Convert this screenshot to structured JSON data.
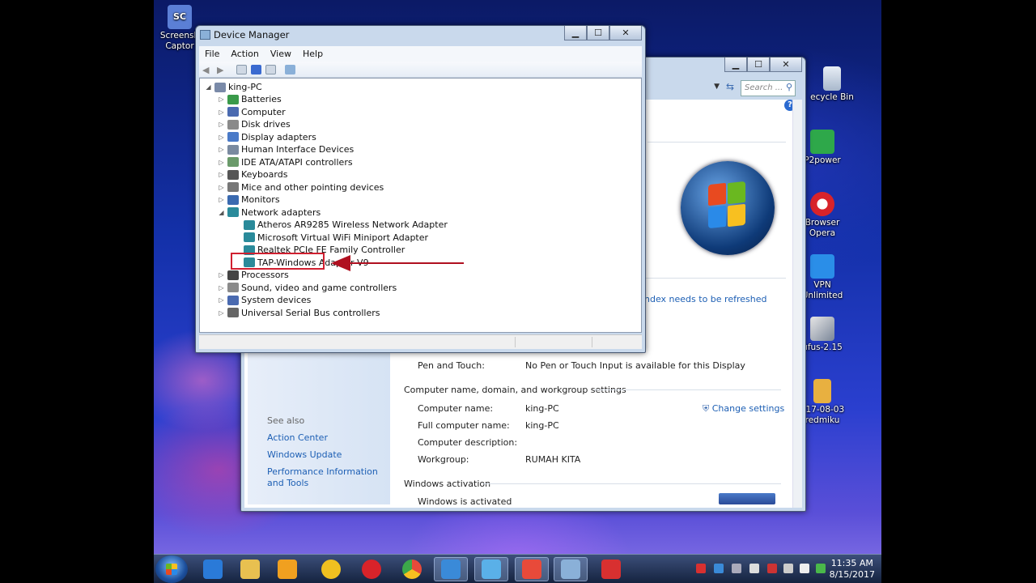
{
  "desktop_icons": [
    {
      "label": "Screensh\nCaptor",
      "color": "#5b7fd6"
    },
    {
      "label": "ecycle Bin",
      "color": "#c9d6e6"
    },
    {
      "label": "P2power",
      "color": "#2ea84a"
    },
    {
      "label": "Browser\nOpera",
      "color": "#d8232a"
    },
    {
      "label": "VPN\nUnlimited",
      "color": "#2a8ee8"
    },
    {
      "label": "ufus-2.15",
      "color": "#9aa6b8"
    },
    {
      "label": "017-08-03\nredmiku",
      "color": "#e8b040"
    }
  ],
  "device_manager": {
    "title": "Device Manager",
    "menu": [
      "File",
      "Action",
      "View",
      "Help"
    ],
    "root": "king-PC",
    "nodes": [
      {
        "label": "Batteries",
        "expanded": false,
        "color": "#3a9a4a"
      },
      {
        "label": "Computer",
        "expanded": false,
        "color": "#4a6ab0"
      },
      {
        "label": "Disk drives",
        "expanded": false,
        "color": "#8a8a8a"
      },
      {
        "label": "Display adapters",
        "expanded": false,
        "color": "#4a7ac8"
      },
      {
        "label": "Human Interface Devices",
        "expanded": false,
        "color": "#7a8aa0"
      },
      {
        "label": "IDE ATA/ATAPI controllers",
        "expanded": false,
        "color": "#6a9a6a"
      },
      {
        "label": "Keyboards",
        "expanded": false,
        "color": "#555"
      },
      {
        "label": "Mice and other pointing devices",
        "expanded": false,
        "color": "#777"
      },
      {
        "label": "Monitors",
        "expanded": false,
        "color": "#3a6ab0"
      },
      {
        "label": "Network adapters",
        "expanded": true,
        "color": "#2a8a9a"
      },
      {
        "label": "Atheros AR9285 Wireless Network Adapter",
        "child": true,
        "color": "#2a8a9a"
      },
      {
        "label": "Microsoft Virtual WiFi Miniport Adapter",
        "child": true,
        "color": "#2a8a9a"
      },
      {
        "label": "Realtek PCIe FE Family Controller",
        "child": true,
        "color": "#2a8a9a"
      },
      {
        "label": "TAP-Windows Adapter V9",
        "child": true,
        "color": "#2a8a9a"
      },
      {
        "label": "Processors",
        "expanded": false,
        "color": "#444"
      },
      {
        "label": "Sound, video and game controllers",
        "expanded": false,
        "color": "#8a8a8a"
      },
      {
        "label": "System devices",
        "expanded": false,
        "color": "#4a6ab0"
      },
      {
        "label": "Universal Serial Bus controllers",
        "expanded": false,
        "color": "#666"
      }
    ]
  },
  "system_window": {
    "search_placeholder": "Search ...",
    "index_link": "ndex needs to be refreshed",
    "pen_touch_label": "Pen and Touch:",
    "pen_touch_value": "No Pen or Touch Input is available for this Display",
    "section_computer": "Computer name, domain, and workgroup settings",
    "computer_name_label": "Computer name:",
    "computer_name_value": "king-PC",
    "full_name_label": "Full computer name:",
    "full_name_value": "king-PC",
    "description_label": "Computer description:",
    "workgroup_label": "Workgroup:",
    "workgroup_value": "RUMAH KITA",
    "change_settings": "Change settings",
    "section_activation": "Windows activation",
    "activated": "Windows is activated",
    "see_also": "See also",
    "links": [
      "Action Center",
      "Windows Update",
      "Performance Information and Tools"
    ]
  },
  "taskbar": {
    "time": "11:35 AM",
    "date": "8/15/2017",
    "apps": [
      {
        "name": "ie-icon",
        "color": "#2a7ad8"
      },
      {
        "name": "explorer-icon",
        "color": "#e8c050"
      },
      {
        "name": "media-player-icon",
        "color": "#f0a020"
      },
      {
        "name": "aimp-icon",
        "color": "#f0c020"
      },
      {
        "name": "opera-icon",
        "color": "#d8232a"
      },
      {
        "name": "chrome-icon",
        "color": "#3ca84a"
      },
      {
        "name": "screenshot-captor-icon",
        "color": "#3a8ad8"
      },
      {
        "name": "system-icon",
        "color": "#5ab0e8"
      },
      {
        "name": "control-panel-icon",
        "color": "#e84a3a"
      },
      {
        "name": "device-manager-icon",
        "color": "#8ab0d8"
      },
      {
        "name": "toolbox-icon",
        "color": "#d83030"
      }
    ]
  }
}
